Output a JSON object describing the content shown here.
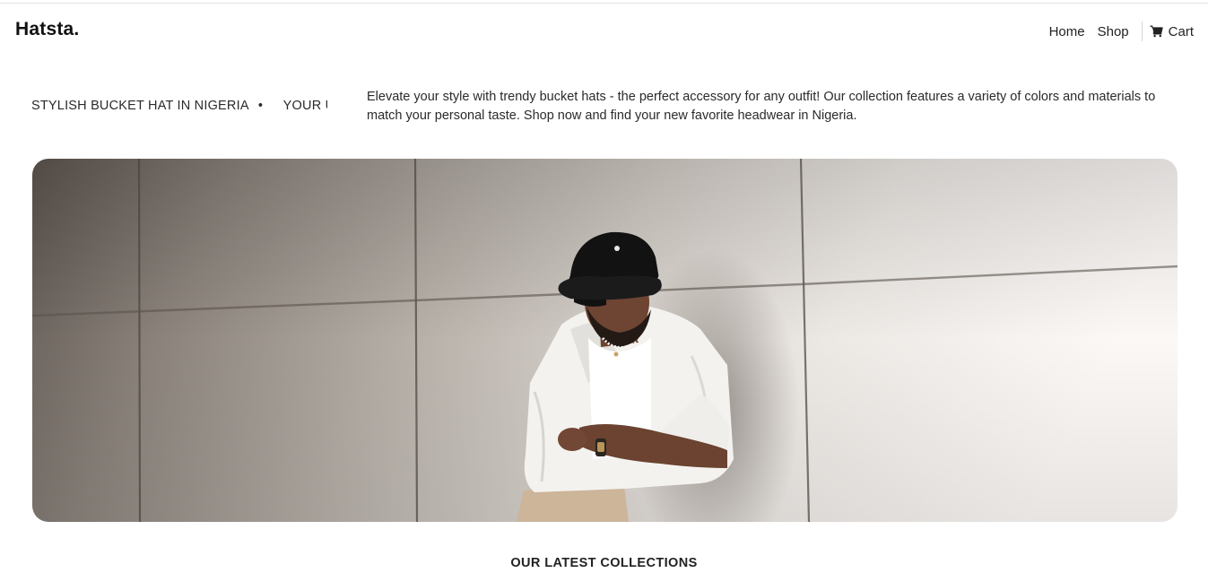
{
  "header": {
    "brand": "Hatsta.",
    "nav": {
      "home": "Home",
      "shop": "Shop",
      "cart": "Cart"
    }
  },
  "ticker": {
    "item1": "STYLISH BUCKET HAT IN NIGERIA",
    "bullet": "•",
    "item2": "YOUR UL"
  },
  "intro": {
    "text": "Elevate your style with trendy bucket hats - the perfect accessory for any outfit! Our collection features a variety of colors and materials to match your personal taste. Shop now and find your new favorite headwear in Nigeria."
  },
  "hero": {
    "image_alt": "Man in black bucket hat and white shirt leaning against a wall"
  },
  "section": {
    "latest_title": "OUR LATEST COLLECTIONS"
  },
  "icons": [
    "cart-icon"
  ]
}
